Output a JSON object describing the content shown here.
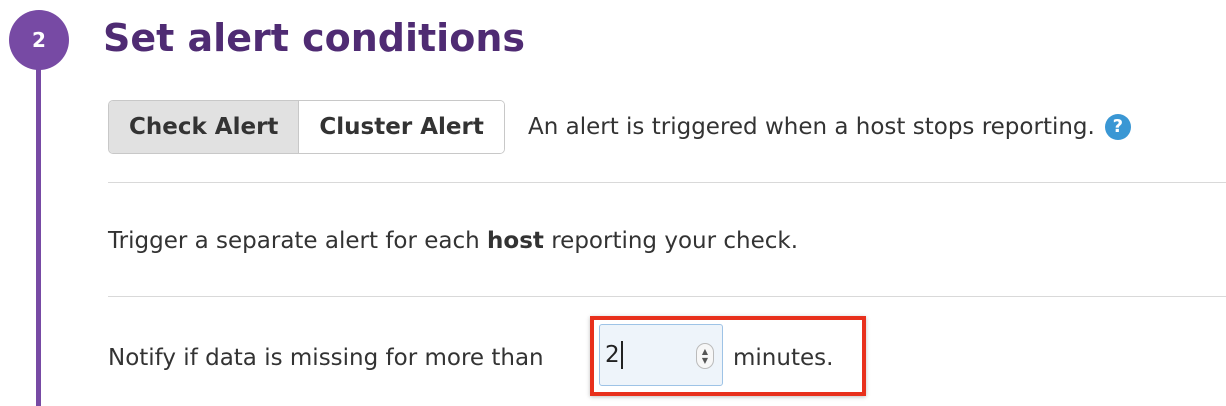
{
  "step": {
    "number": "2",
    "title": "Set alert conditions"
  },
  "alert_type": {
    "options": [
      "Check Alert",
      "Cluster Alert"
    ],
    "selected": "Check Alert",
    "description": "An alert is triggered when a host stops reporting.",
    "help_icon": "question-circle-icon",
    "help_symbol": "?"
  },
  "trigger": {
    "prefix": "Trigger a separate alert for each",
    "bold": "host",
    "suffix": "reporting your check."
  },
  "notify": {
    "label": "Notify if data is missing for more than",
    "value": "2",
    "unit": "minutes."
  },
  "colors": {
    "accent": "#774aa4",
    "title": "#4f2b73",
    "highlight_border": "#e8301c",
    "help_icon": "#3a97d4"
  }
}
